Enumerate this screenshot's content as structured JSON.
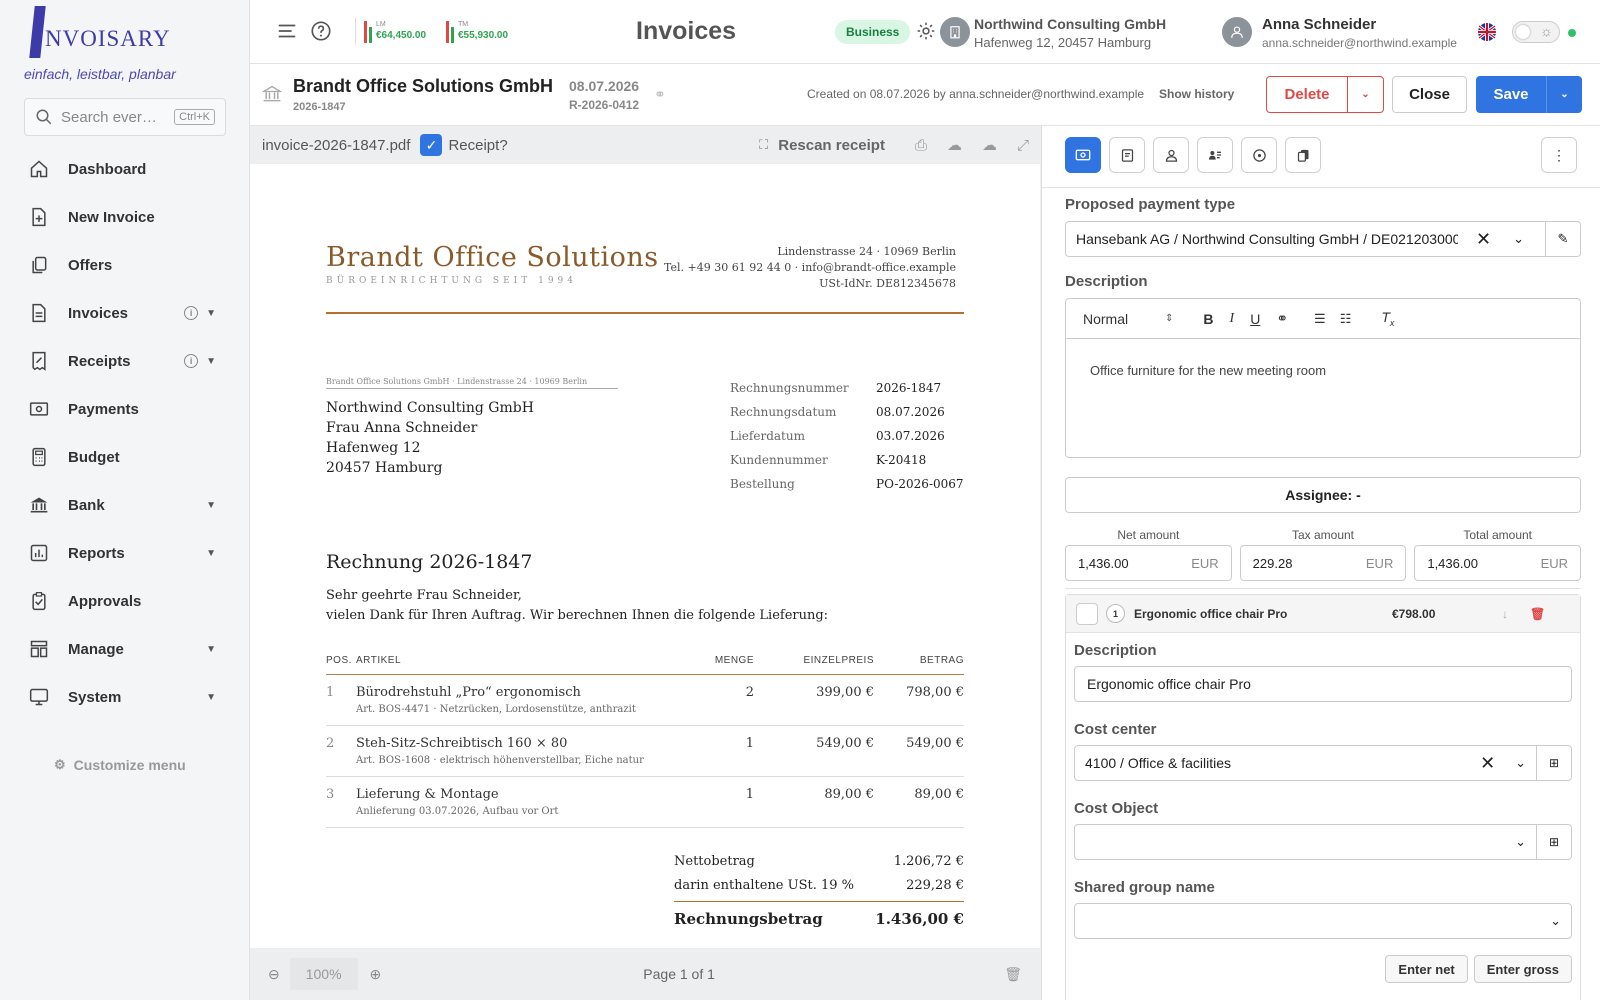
{
  "sidebar": {
    "logo_text": "NVOISARY",
    "tagline": "einfach, leistbar, planbar",
    "search_placeholder": "Search ever…",
    "search_shortcut": "Ctrl+K",
    "items": [
      {
        "label": "Dashboard",
        "icon": "home-icon"
      },
      {
        "label": "New Invoice",
        "icon": "file-plus-icon"
      },
      {
        "label": "Offers",
        "icon": "copy-icon"
      },
      {
        "label": "Invoices",
        "icon": "file-icon"
      },
      {
        "label": "Receipts",
        "icon": "receipt-icon"
      },
      {
        "label": "Payments",
        "icon": "cash-icon"
      },
      {
        "label": "Budget",
        "icon": "calculator-icon"
      },
      {
        "label": "Bank",
        "icon": "bank-icon"
      },
      {
        "label": "Reports",
        "icon": "chart-icon"
      },
      {
        "label": "Approvals",
        "icon": "clipboard-check-icon"
      },
      {
        "label": "Manage",
        "icon": "layout-icon"
      },
      {
        "label": "System",
        "icon": "monitor-icon"
      }
    ],
    "customize": "Customize menu"
  },
  "topbar": {
    "kpi_lm_label": "LM",
    "kpi_lm_value": "€64,450.00",
    "kpi_tm_label": "TM",
    "kpi_tm_value": "€55,930.00",
    "title": "Invoices",
    "badge": "Business",
    "company_name": "Northwind Consulting GmbH",
    "company_address": "Hafenweg 12, 20457 Hamburg",
    "user_name": "Anna Schneider",
    "user_email": "anna.schneider@northwind.example",
    "colors": {
      "accent": "#2f74e0",
      "success": "#2da44e",
      "danger": "#e04848"
    }
  },
  "doc": {
    "title": "Brandt Office Solutions GmbH",
    "number": "2026-1847",
    "date": "08.07.2026",
    "ref": "R-2026-0412",
    "created": "Created on 08.07.2026 by anna.schneider@northwind.example",
    "history": "Show history",
    "delete": "Delete",
    "close": "Close",
    "save": "Save"
  },
  "viewer": {
    "filename": "invoice-2026-1847.pdf",
    "receipt_label": "Receipt?",
    "rescan": "Rescan receipt",
    "zoom": "100%",
    "page_info": "Page 1 of 1"
  },
  "invoice": {
    "vendor": "Brandt Office Solutions",
    "vendor_tagline": "BÜROEINRICHTUNG SEIT 1994",
    "vendor_addr1": "Lindenstrasse 24 · 10969 Berlin",
    "vendor_addr2": "Tel. +49 30 61 92 44 0 · info@brandt-office.example",
    "vendor_addr3": "USt-IdNr. DE812345678",
    "sender_line": "Brandt Office Solutions GmbH · Lindenstrasse 24 · 10969 Berlin",
    "recipient": [
      "Northwind Consulting GmbH",
      "Frau Anna Schneider",
      "Hafenweg 12",
      "20457 Hamburg"
    ],
    "meta": [
      {
        "k": "Rechnungsnummer",
        "v": "2026-1847"
      },
      {
        "k": "Rechnungsdatum",
        "v": "08.07.2026"
      },
      {
        "k": "Lieferdatum",
        "v": "03.07.2026"
      },
      {
        "k": "Kundennummer",
        "v": "K-20418"
      },
      {
        "k": "Bestellung",
        "v": "PO-2026-0067"
      }
    ],
    "heading": "Rechnung 2026-1847",
    "greeting": "Sehr geehrte Frau Schneider,",
    "intro": "vielen Dank für Ihren Auftrag. Wir berechnen Ihnen die folgende Lieferung:",
    "columns": {
      "pos": "POS.",
      "article": "ARTIKEL",
      "qty": "MENGE",
      "unit": "EINZELPREIS",
      "amount": "BETRAG"
    },
    "lines": [
      {
        "pos": "1",
        "name": "Bürodrehstuhl „Pro“ ergonomisch",
        "detail": "Art. BOS-4471 · Netzrücken, Lordosenstütze, anthrazit",
        "qty": "2",
        "unit": "399,00 €",
        "amount": "798,00 €"
      },
      {
        "pos": "2",
        "name": "Steh-Sitz-Schreibtisch 160 × 80",
        "detail": "Art. BOS-1608 · elektrisch höhenverstellbar, Eiche natur",
        "qty": "1",
        "unit": "549,00 €",
        "amount": "549,00 €"
      },
      {
        "pos": "3",
        "name": "Lieferung & Montage",
        "detail": "Anlieferung 03.07.2026, Aufbau vor Ort",
        "qty": "1",
        "unit": "89,00 €",
        "amount": "89,00 €"
      }
    ],
    "net_label": "Nettobetrag",
    "net": "1.206,72 €",
    "vat_label": "darin enthaltene USt. 19 %",
    "vat": "229,28 €",
    "total_label": "Rechnungsbetrag",
    "total": "1.436,00 €"
  },
  "panel": {
    "payment_label": "Proposed payment type",
    "payment_value": "Hansebank AG / Northwind Consulting GmbH / DE021203000",
    "description_label": "Description",
    "editor_format": "Normal",
    "description_text": "Office furniture for the new meeting room",
    "assignee": "Assignee: -",
    "net_label": "Net amount",
    "net_value": "1,436.00",
    "tax_label": "Tax amount",
    "tax_value": "229.28",
    "total_label": "Total amount",
    "total_value": "1,436.00",
    "currency": "EUR",
    "line_index": "1",
    "line_name": "Ergonomic office chair Pro",
    "line_amount": "€798.00",
    "line_desc_label": "Description",
    "line_desc_value": "Ergonomic office chair Pro",
    "cost_center_label": "Cost center",
    "cost_center_value": "4100 / Office & facilities",
    "cost_object_label": "Cost Object",
    "shared_group_label": "Shared group name",
    "enter_net": "Enter net",
    "enter_gross": "Enter gross"
  }
}
